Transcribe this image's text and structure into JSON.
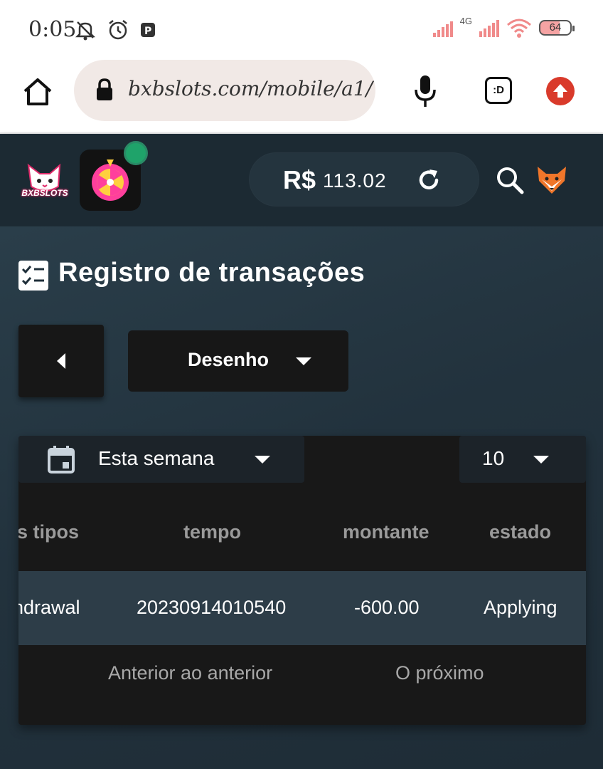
{
  "status_bar": {
    "time": "0:05",
    "network": "4G",
    "battery": "64"
  },
  "browser": {
    "url": "bxbslots.com/mobile/a1/",
    "extension_label": ":D"
  },
  "header": {
    "brand": "BXBSLOTS",
    "currency": "R$",
    "balance": "113.02"
  },
  "page": {
    "title": "Registro de transações",
    "type_filter": "Desenho",
    "date_filter": "Esta semana",
    "page_size": "10"
  },
  "table": {
    "columns": [
      "s tipos",
      "tempo",
      "montante",
      "estado"
    ],
    "rows": [
      [
        "hdrawal",
        "20230914010540",
        "-600.00",
        "Applying"
      ]
    ]
  },
  "pager": {
    "prev_label": "Anterior ao anterior",
    "next_label": "O próximo"
  },
  "colors": {
    "accent_notification": "#1fa36a",
    "update_button": "#d93a2b",
    "row_highlight": "#2d3d48"
  }
}
